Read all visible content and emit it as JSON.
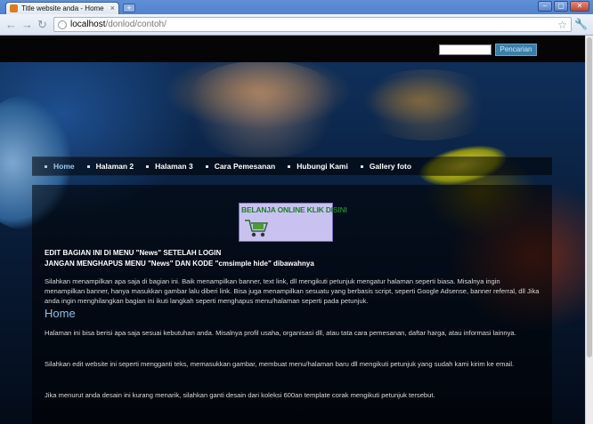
{
  "browser": {
    "tab_title": "Title website anda - Home",
    "tab_close": "×",
    "new_tab": "+",
    "url_host": "localhost",
    "url_path": "/donlod/contoh/",
    "back": "←",
    "forward": "→",
    "reload": "↻",
    "star": "☆",
    "wrench": "🔧",
    "minimize": "–",
    "maximize": "▢",
    "close": "✕"
  },
  "search": {
    "value": "",
    "button_label": "Pencarian"
  },
  "nav": {
    "items": [
      {
        "label": "Home",
        "active": true
      },
      {
        "label": "Halaman 2",
        "active": false
      },
      {
        "label": "Halaman 3",
        "active": false
      },
      {
        "label": "Cara Pemesanan",
        "active": false
      },
      {
        "label": "Hubungi Kami",
        "active": false
      },
      {
        "label": "Gallery foto",
        "active": false
      }
    ]
  },
  "promo": {
    "text": "BELANJA ONLINE KLIK DISINI"
  },
  "content": {
    "edit_note_1": "EDIT BAGIAN INI DI MENU \"News\" SETELAH LOGIN",
    "edit_note_2": "JANGAN MENGHAPUS MENU \"News\" DAN KODE \"cmsimple hide\" dibawahnya",
    "banner_para": "Silahkan menampilkan apa saja di bagian ini. Baik menampilkan banner, text link, dll mengikuti petunjuk mengatur halaman seperti biasa. Misalnya ingin menampilkan banner, hanya masukkan gambar lalu diberi link. Bisa juga menampilkan sesuatu yang berbasis script, seperti Google Adsense, banner referral, dll Jika anda ingin menghilangkan bagian ini ikuti langkah seperti menghapus menu/halaman seperti pada petunjuk.",
    "heading": "Home",
    "para_1": "Halaman ini bisa berisi apa saja sesuai kebutuhan anda. Misalnya profil usaha, organisasi dll, atau tata cara pemesanan, daftar harga, atau informasi lainnya.",
    "para_2": "Silahkan edit website ini seperti mengganti teks, memasukkan gambar, membuat menu/halaman baru dll mengikuti petunjuk yang sudah kami kirim ke email.",
    "para_3": "Jika menurut anda desain ini kurang menarik, silahkan ganti desain dari koleksi 600an template corak mengikuti petunjuk tersebut."
  }
}
